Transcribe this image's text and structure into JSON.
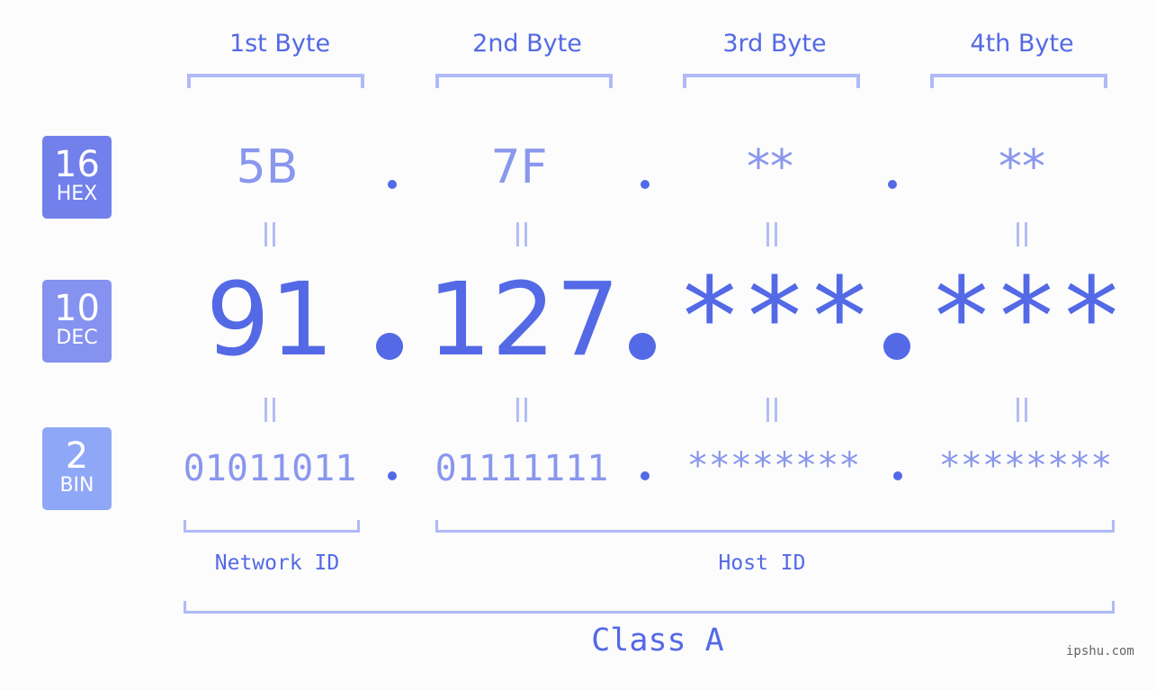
{
  "bytes": {
    "labels": [
      "1st Byte",
      "2nd Byte",
      "3rd Byte",
      "4th Byte"
    ]
  },
  "bases": [
    {
      "number": "16",
      "name": "HEX",
      "color": "#7280ec"
    },
    {
      "number": "10",
      "name": "DEC",
      "color": "#8592f0"
    },
    {
      "number": "2",
      "name": "BIN",
      "color": "#8ea7f7"
    }
  ],
  "hex": [
    "5B",
    "7F",
    "**",
    "**"
  ],
  "dec": [
    "91",
    "127",
    "***",
    "***"
  ],
  "bin": [
    "01011011",
    "01111111",
    "********",
    "********"
  ],
  "separator": ".",
  "segments": {
    "network_id": "Network ID",
    "host_id": "Host ID",
    "class": "Class A"
  },
  "watermark": "ipshu.com",
  "colors": {
    "accent": "#5469e6",
    "light_accent": "#8a97ee",
    "bracket": "#b0baf8",
    "background": "#fbfcfb"
  }
}
